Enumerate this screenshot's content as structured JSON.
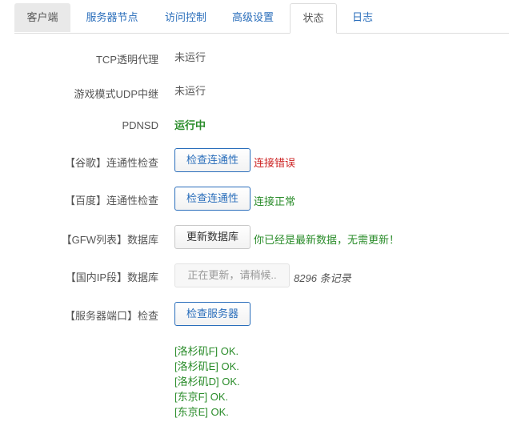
{
  "tabs": [
    {
      "label": "客户端"
    },
    {
      "label": "服务器节点"
    },
    {
      "label": "访问控制"
    },
    {
      "label": "高级设置"
    },
    {
      "label": "状态"
    },
    {
      "label": "日志"
    }
  ],
  "rows": {
    "tcp": {
      "label": "TCP透明代理",
      "value": "未运行"
    },
    "udp": {
      "label": "游戏模式UDP中继",
      "value": "未运行"
    },
    "pdnsd": {
      "label": "PDNSD",
      "value": "运行中"
    },
    "google": {
      "label": "【谷歌】连通性检查",
      "button": "检查连通性",
      "status": "连接错误"
    },
    "baidu": {
      "label": "【百度】连通性检查",
      "button": "检查连通性",
      "status": "连接正常"
    },
    "gfw": {
      "label": "【GFW列表】数据库",
      "button": "更新数据库",
      "status": "你已经是最新数据，无需更新！"
    },
    "chnip": {
      "label": "【国内IP段】数据库",
      "button": "正在更新，请稍候..",
      "status": "8296 条记录"
    },
    "server": {
      "label": "【服务器端口】检查",
      "button": "检查服务器"
    }
  },
  "server_results": [
    "[洛杉矶F] OK.",
    "[洛杉矶E] OK.",
    "[洛杉矶D] OK.",
    "[东京F] OK.",
    "[东京E] OK."
  ],
  "colors": {
    "accent": "#2a6ebb",
    "ok": "#2a8c2a",
    "error": "#cc2222"
  }
}
